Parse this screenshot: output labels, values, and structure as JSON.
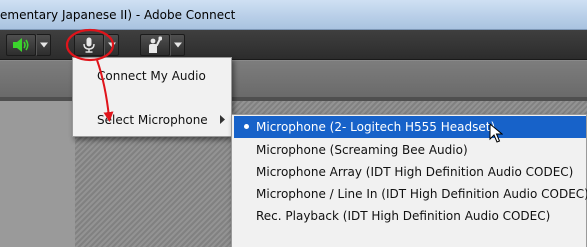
{
  "window": {
    "title": "ementary Japanese II) - Adobe Connect"
  },
  "toolbar": {
    "speaker_icon": "speaker-icon",
    "mic_icon": "microphone-icon",
    "raise_hand_icon": "raise-hand-icon",
    "speaker_color": "#3bd42c"
  },
  "audio_menu": {
    "items": [
      {
        "label": "Connect My Audio",
        "has_submenu": false
      },
      {
        "label": "Select Microphone",
        "has_submenu": true
      }
    ]
  },
  "microphone_submenu": {
    "items": [
      {
        "label": "Microphone (2- Logitech H555 Headset)",
        "selected": true
      },
      {
        "label": "Microphone (Screaming Bee Audio)",
        "selected": false
      },
      {
        "label": "Microphone Array (IDT High Definition Audio CODEC)",
        "selected": false
      },
      {
        "label": "Microphone / Line In (IDT High Definition Audio CODEC)",
        "selected": false
      },
      {
        "label": "Rec. Playback (IDT High Definition Audio CODEC)",
        "selected": false
      }
    ]
  },
  "colors": {
    "highlight": "#1762c9",
    "annotation": "#e0141b"
  }
}
